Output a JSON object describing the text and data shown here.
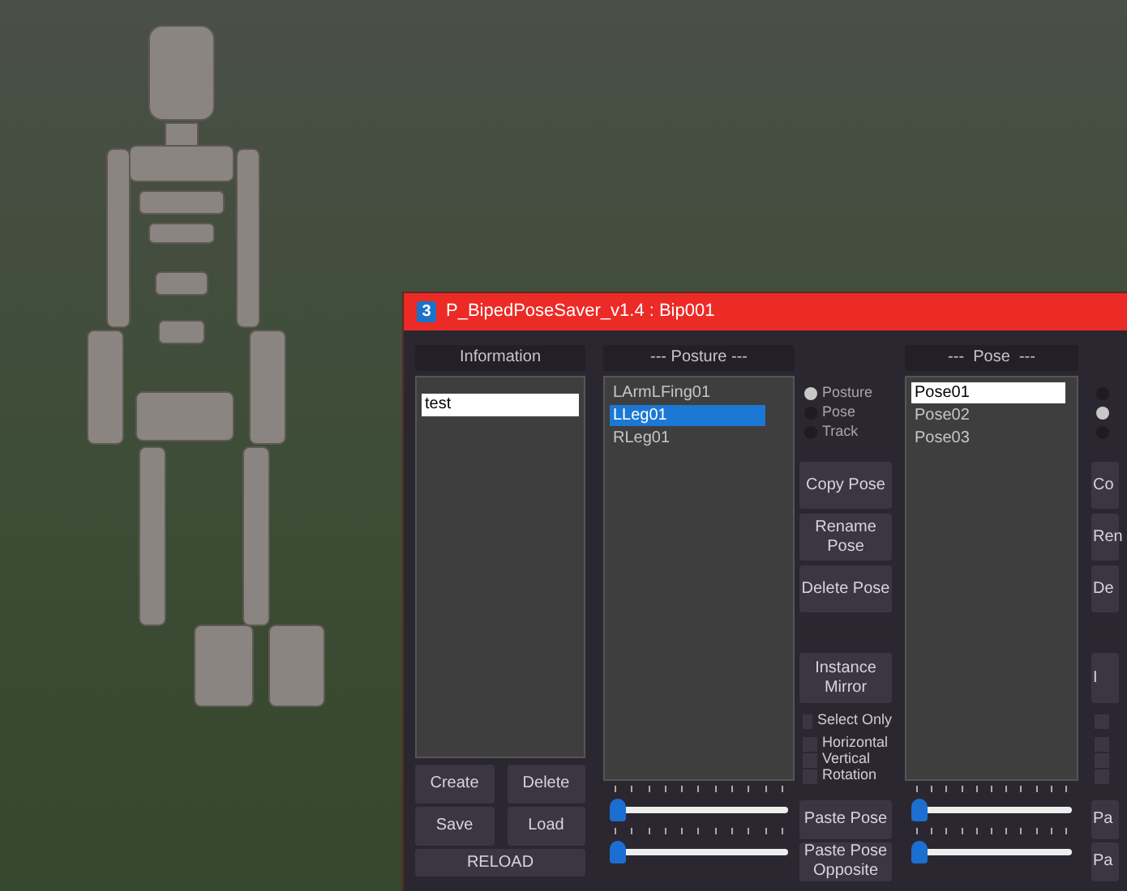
{
  "window": {
    "title": "P_BipedPoseSaver_v1.4 : Bip001",
    "app_icon": "3"
  },
  "information": {
    "header": "Information",
    "input_value": "test",
    "buttons": [
      "Create",
      "Delete",
      "Save",
      "Load"
    ],
    "reload": "RELOAD"
  },
  "posture": {
    "header": "--- Posture ---",
    "items": [
      {
        "label": "LArmLFing01",
        "selected": false
      },
      {
        "label": "LLeg01",
        "selected": true
      },
      {
        "label": "RLeg01",
        "selected": false
      }
    ],
    "sliders": [
      {
        "level": 0
      },
      {
        "level": 0
      }
    ]
  },
  "mode_options": [
    {
      "label": "Posture",
      "selected": true
    },
    {
      "label": "Pose",
      "selected": false
    },
    {
      "label": "Track",
      "selected": false
    }
  ],
  "pose_buttons": [
    "Copy Pose",
    "Rename Pose",
    "Delete Pose",
    "Instance Mirror"
  ],
  "checkboxes": [
    {
      "label": "Select Only",
      "checked": false
    },
    {
      "label": "Horizontal",
      "checked": false
    },
    {
      "label": "Vertical",
      "checked": false
    },
    {
      "label": "Rotation",
      "checked": false
    }
  ],
  "paste_buttons": [
    "Paste Pose",
    "Paste Pose Opposite"
  ],
  "pose": {
    "header": "---  Pose  ---",
    "items": [
      {
        "label": "Pose01",
        "selected": true
      },
      {
        "label": "Pose02",
        "selected": false
      },
      {
        "label": "Pose03",
        "selected": false
      }
    ],
    "sliders": [
      {
        "level": 0
      },
      {
        "level": 0
      }
    ]
  },
  "cut_off_column": {
    "mode_options": [
      {
        "selected": false
      },
      {
        "selected": true
      },
      {
        "selected": false
      }
    ],
    "pose_buttons": [
      "Co",
      "Ren",
      "De",
      "I"
    ],
    "checkboxes": [
      {
        "checked": false
      },
      {
        "checked": false
      },
      {
        "checked": false
      },
      {
        "checked": false
      }
    ],
    "paste_buttons": [
      "Pa",
      "Pa"
    ]
  }
}
